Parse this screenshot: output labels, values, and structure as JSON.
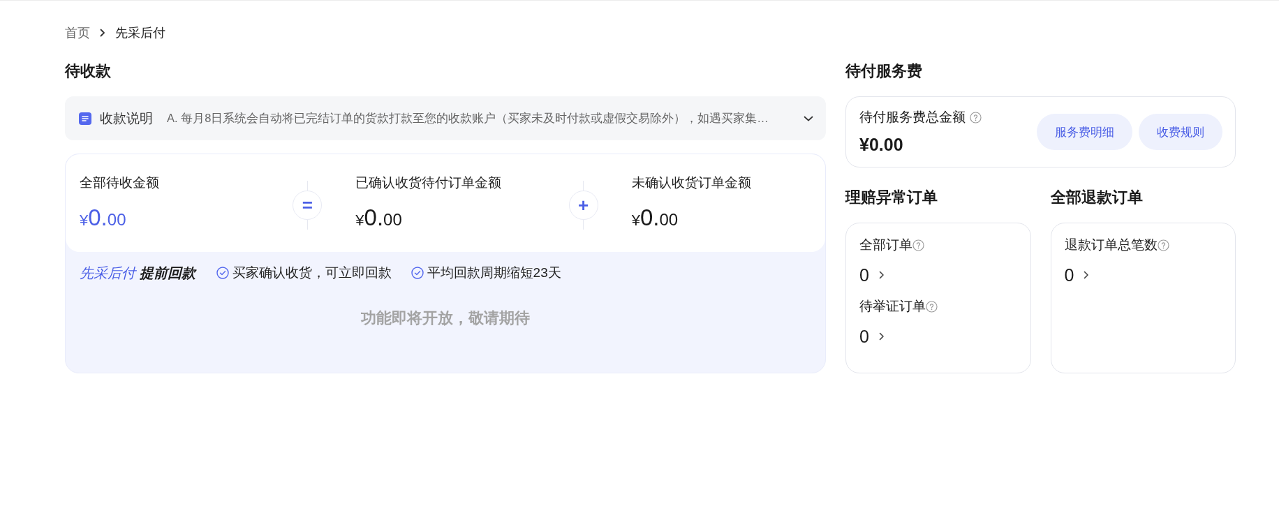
{
  "breadcrumb": [
    {
      "label": "首页",
      "current": false
    },
    {
      "label": "先采后付",
      "current": true
    }
  ],
  "receivables": {
    "title": "待收款",
    "notice": {
      "title": "收款说明",
      "text": "A. 每月8日系统会自动将已完结订单的货款打款至您的收款账户（买家未及时付款或虚假交易除外），如遇买家集…",
      "expanded": false
    },
    "summary": [
      {
        "label": "全部待收金额",
        "amount": {
          "currency": "¥",
          "main": "0.",
          "minor": "00"
        },
        "highlighted": true
      },
      {
        "operator": "=",
        "label": "已确认收货待付订单金额",
        "amount": {
          "currency": "¥",
          "main": "0.",
          "minor": "00"
        },
        "highlighted": false
      },
      {
        "operator": "+",
        "label": "未确认收货订单金额",
        "amount": {
          "currency": "¥",
          "main": "0.",
          "minor": "00"
        },
        "highlighted": false
      }
    ],
    "promo": {
      "brand": "先采后付",
      "headline": "提前回款",
      "benefits": [
        "买家确认收货，可立即回款",
        "平均回款周期缩短23天"
      ],
      "empty_message": "功能即将开放，敬请期待"
    }
  },
  "service_fee": {
    "title": "待付服务费",
    "label": "待付服务费总金额",
    "amount": "¥0.00",
    "buttons": [
      "服务费明细",
      "收费规则"
    ]
  },
  "order_panels": [
    {
      "title": "理赔异常订单",
      "stats": [
        {
          "label": "全部订单",
          "value": "0"
        },
        {
          "label": "待举证订单",
          "value": "0"
        }
      ]
    },
    {
      "title": "全部退款订单",
      "stats": [
        {
          "label": "退款订单总笔数",
          "value": "0"
        }
      ]
    }
  ]
}
